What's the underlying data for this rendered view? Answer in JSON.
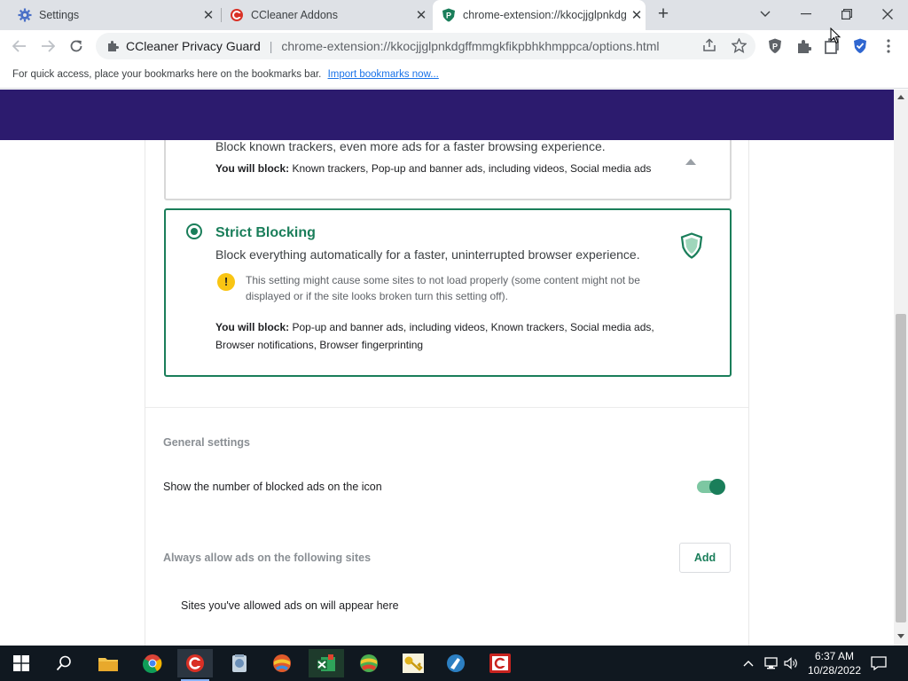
{
  "tabs": [
    {
      "title": "Settings",
      "icon": "gear-icon"
    },
    {
      "title": "CCleaner Addons",
      "icon": "ccleaner-icon"
    },
    {
      "title": "chrome-extension://kkocjjglpnkdg",
      "icon": "privacy-guard-icon",
      "active": true
    }
  ],
  "toolbar": {
    "site_name": "CCleaner Privacy Guard",
    "url": "chrome-extension://kkocjjglpnkdgffmmgkfikpbhkhmppca/options.html"
  },
  "bookmarks_bar": {
    "text": "For quick access, place your bookmarks here on the bookmarks bar.",
    "link": "Import bookmarks now..."
  },
  "options": {
    "previous_card": {
      "description": "Block known trackers, even more ads for a faster browsing experience.",
      "block_label": "You will block:",
      "block_items": "Known trackers, Pop-up and banner ads, including videos, Social media ads"
    },
    "strict_card": {
      "title": "Strict Blocking",
      "description": "Block everything automatically for a faster, uninterrupted browser experience.",
      "warning": "This setting might cause some sites to not load properly (some content might not be displayed or if the site looks broken turn this setting off).",
      "block_label": "You will block:",
      "block_items": "Pop-up and banner ads, including videos, Known trackers, Social media ads, Browser notifications, Browser fingerprinting",
      "selected": true
    },
    "general": {
      "title": "General settings",
      "show_count_label": "Show the number of blocked ads on the icon",
      "show_count_enabled": true
    },
    "allow_list": {
      "title": "Always allow ads on the following sites",
      "add_label": "Add",
      "empty_text": "Sites you've allowed ads on will appear here"
    }
  },
  "taskbar": {
    "time": "6:37 AM",
    "date": "10/28/2022"
  },
  "colors": {
    "accent": "#1a7e5a",
    "header_band": "#2c1b6e"
  }
}
